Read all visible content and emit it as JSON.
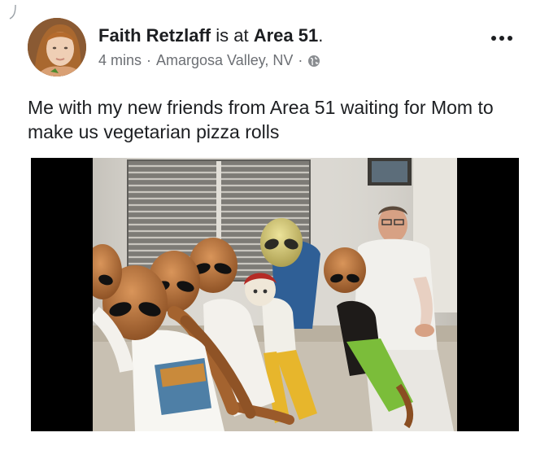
{
  "post": {
    "author": "Faith Retzlaff",
    "connector": "is at",
    "place": "Area 51",
    "place_suffix": ".",
    "time": "4 mins",
    "separator": "·",
    "location": "Amargosa Valley, NV",
    "privacy_icon": "globe-icon",
    "menu_icon": "more-options-icon",
    "text": "Me with my new friends from Area 51 waiting for Mom to make us vegetarian pizza rolls"
  },
  "colors": {
    "name_text": "#1c1e21",
    "meta_text": "#6c6f74",
    "photo_letterbox": "#000000"
  }
}
